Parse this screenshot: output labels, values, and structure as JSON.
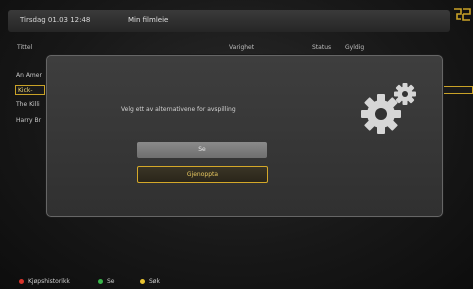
{
  "header": {
    "datetime": "Tirsdag 01.03 12:48",
    "title": "Min filmleie"
  },
  "columns": {
    "title": "Tittel",
    "duration": "Varighet",
    "status": "Status",
    "valid": "Gyldig"
  },
  "list": {
    "items": [
      {
        "label": "An Amer"
      },
      {
        "label": "Kick-Ass"
      },
      {
        "label": "The Killi"
      },
      {
        "label": "Harry Br"
      }
    ],
    "selected_index": 1
  },
  "dialog": {
    "message": "Velg ett av alternativene for avspilling",
    "button_play": "Se",
    "button_resume": "Gjenoppta",
    "focused_button": "Gjenoppta"
  },
  "footer": {
    "red": {
      "label": "Kjøpshistorikk",
      "color": "#d9342b"
    },
    "green": {
      "label": "Se",
      "color": "#39b54a"
    },
    "yellow": {
      "label": "Søk",
      "color": "#e8c230"
    }
  },
  "colors": {
    "accent": "#d4a829",
    "background": "#181818"
  }
}
